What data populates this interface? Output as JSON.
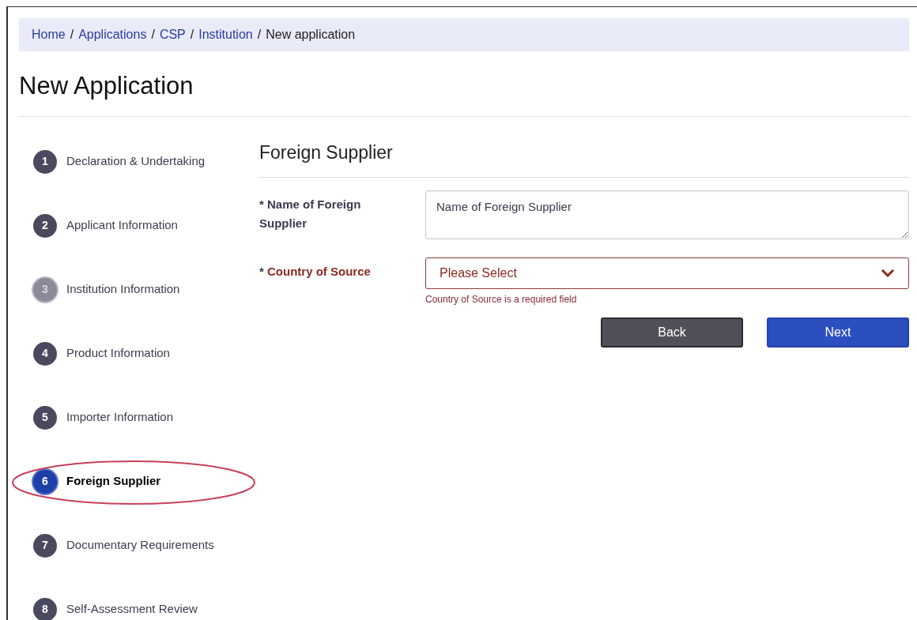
{
  "breadcrumb": [
    {
      "label": "Home",
      "link": true
    },
    {
      "label": "Applications",
      "link": true
    },
    {
      "label": "CSP",
      "link": true
    },
    {
      "label": "Institution",
      "link": true
    },
    {
      "label": "New application",
      "link": false
    }
  ],
  "breadcrumb_separator": "/",
  "title": "New Application",
  "steps": [
    {
      "number": "1",
      "label": "Declaration & Undertaking",
      "disabled": false,
      "selected": false,
      "circled": false
    },
    {
      "number": "2",
      "label": "Applicant Information",
      "disabled": false,
      "selected": false,
      "circled": false
    },
    {
      "number": "3",
      "label": "Institution Information",
      "disabled": true,
      "selected": false,
      "circled": false
    },
    {
      "number": "4",
      "label": "Product Information",
      "disabled": false,
      "selected": false,
      "circled": false
    },
    {
      "number": "5",
      "label": "Importer Information",
      "disabled": false,
      "selected": false,
      "circled": false
    },
    {
      "number": "6",
      "label": "Foreign Supplier",
      "disabled": false,
      "selected": true,
      "circled": true
    },
    {
      "number": "7",
      "label": "Documentary Requirements",
      "disabled": false,
      "selected": false,
      "circled": false
    },
    {
      "number": "8",
      "label": "Self-Assessment Review",
      "disabled": false,
      "selected": false,
      "circled": false
    }
  ],
  "section_title": "Foreign Supplier",
  "fields": [
    {
      "kind": "textarea",
      "required_mark": "*",
      "label": "Name of Foreign Supplier",
      "placeholder": "Name of Foreign Supplier",
      "invalid": false
    },
    {
      "kind": "select",
      "required_mark": "*",
      "label": "Country of Source",
      "value": "Please Select",
      "invalid": true,
      "error": "Country of Source is a required field"
    }
  ],
  "buttons": [
    {
      "label": "Back",
      "kind": "secondary"
    },
    {
      "label": "Next",
      "kind": "primary"
    }
  ]
}
